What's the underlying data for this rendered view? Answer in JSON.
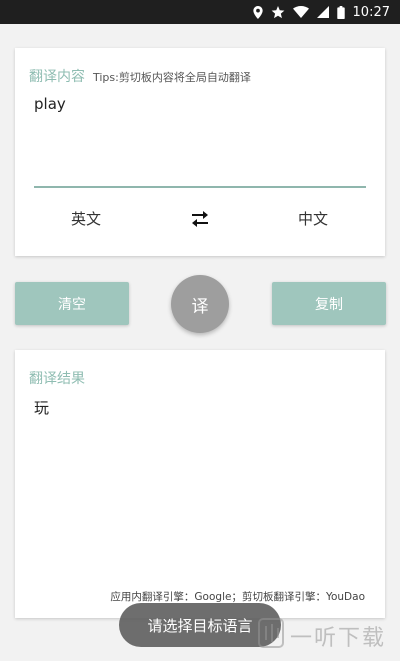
{
  "status_bar": {
    "time": "10:27",
    "icons": [
      "location-icon",
      "star-icon",
      "wifi-icon",
      "signal-icon",
      "battery-icon"
    ]
  },
  "input_card": {
    "title": "翻译内容",
    "tips": "Tips:剪切板内容将全局自动翻译",
    "input_value": "play",
    "source_language": "英文",
    "target_language": "中文",
    "swap_icon": "swap-arrows-icon"
  },
  "actions": {
    "clear_label": "清空",
    "translate_label": "译",
    "copy_label": "复制"
  },
  "output_card": {
    "title": "翻译结果",
    "result": "玩",
    "engine_note": "应用内翻译引擎：Google；剪切板翻译引擎：YouDao"
  },
  "toast": {
    "message": "请选择目标语言"
  },
  "watermark": {
    "text": "一听下载"
  },
  "colors": {
    "accent": "#8fbdb2",
    "button": "#9fc6bd",
    "translate_button": "#9e9e9e",
    "status_bar": "#1f1f1f"
  }
}
